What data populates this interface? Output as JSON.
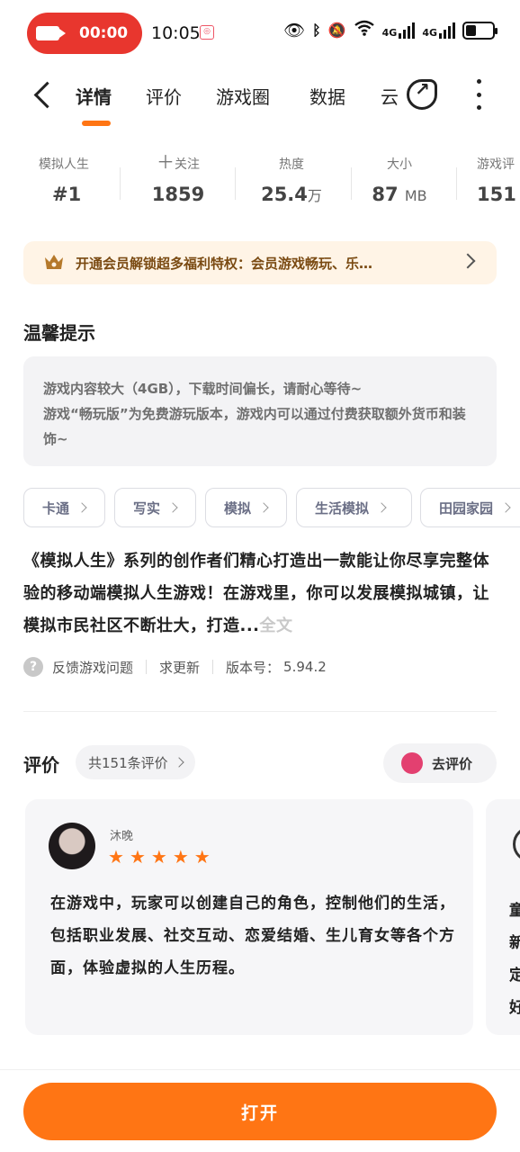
{
  "status_bar": {
    "record_time": "00:00",
    "clock": "10:05",
    "net1": "4G",
    "net2": "4G"
  },
  "tabs": {
    "items": [
      {
        "label": "详情"
      },
      {
        "label": "评价"
      },
      {
        "label": "游戏圈"
      },
      {
        "label": "数据"
      },
      {
        "label": "云"
      }
    ]
  },
  "stats": {
    "rank": {
      "label": "模拟人生",
      "value": "#1"
    },
    "follow": {
      "label": "关注",
      "value": "1859"
    },
    "heat": {
      "label": "热度",
      "value": "25.4",
      "unit": "万"
    },
    "size": {
      "label": "大小",
      "value": "87",
      "unit": "MB"
    },
    "reviews": {
      "label": "游戏评",
      "value": "151"
    }
  },
  "vip_banner": {
    "text": "开通会员解锁超多福利特权：会员游戏畅玩、乐…"
  },
  "tips": {
    "title": "温馨提示",
    "lines": [
      "游戏内容较大（4GB），下载时间偏长，请耐心等待~",
      "游戏“畅玩版”为免费游玩版本，游戏内可以通过付费获取额外货币和装饰~"
    ]
  },
  "tags": [
    "卡通",
    "写实",
    "模拟",
    "生活模拟",
    "田园家园"
  ],
  "description": {
    "text": "《模拟人生》系列的创作者们精心打造出一款能让你尽享完整体验的移动端模拟人生游戏！在游戏里，你可以发展模拟城镇，让模拟市民社区不断壮大，打造...",
    "more_label": "全文"
  },
  "feedback": {
    "report": "反馈游戏问题",
    "request_update": "求更新",
    "version_label": "版本号：",
    "version": "5.94.2"
  },
  "reviews": {
    "title": "评价",
    "count_label": "共151条评价",
    "go_review": "去评价",
    "cards": [
      {
        "user": "沐晚",
        "stars": 5,
        "text": "在游戏中，玩家可以创建自己的角色，控制他们的生活，包括职业发展、社交互动、恋爱结婚、生儿育女等各个方面，体验虚拟的人生历程。"
      },
      {
        "peek_text": "童新定好"
      }
    ]
  },
  "bottom": {
    "open_label": "打开"
  },
  "colors": {
    "accent": "#ff7514",
    "record_red": "#e8362e",
    "vip_bg": "#fff4e6"
  }
}
